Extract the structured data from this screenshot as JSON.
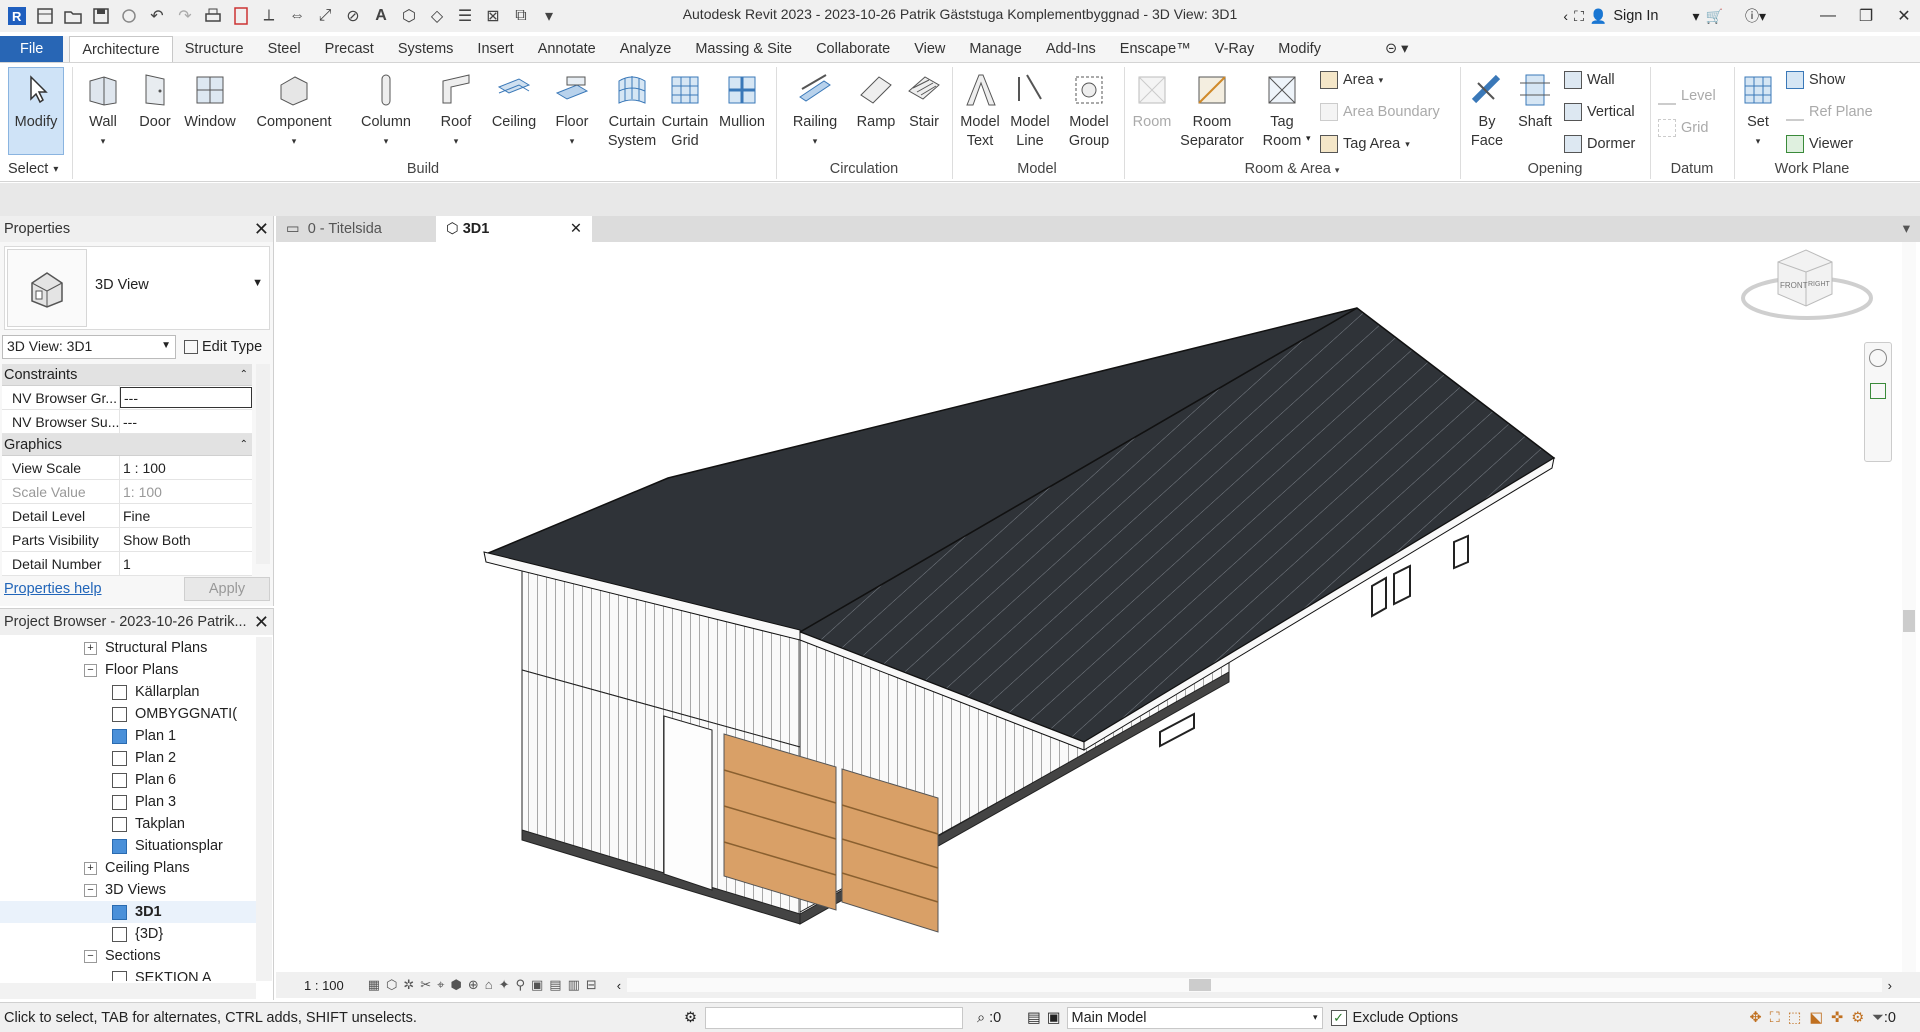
{
  "window": {
    "title": "Autodesk Revit 2023 - 2023-10-26 Patrik Gäststuga Komplementbyggnad - 3D View: 3D1",
    "sign_in": "Sign In"
  },
  "ribbon_tabs": [
    "File",
    "Architecture",
    "Structure",
    "Steel",
    "Precast",
    "Systems",
    "Insert",
    "Annotate",
    "Analyze",
    "Massing & Site",
    "Collaborate",
    "View",
    "Manage",
    "Add-Ins",
    "Enscape™",
    "V-Ray",
    "Modify"
  ],
  "ribbon": {
    "select": {
      "modify": "Modify",
      "select_label": "Select"
    },
    "build": {
      "label": "Build",
      "wall": "Wall",
      "door": "Door",
      "window": "Window",
      "component": "Component",
      "column": "Column",
      "roof": "Roof",
      "ceiling": "Ceiling",
      "floor": "Floor",
      "curtain_system_1": "Curtain",
      "curtain_system_2": "System",
      "curtain_grid_1": "Curtain",
      "curtain_grid_2": "Grid",
      "mullion": "Mullion"
    },
    "circulation": {
      "label": "Circulation",
      "railing": "Railing",
      "ramp": "Ramp",
      "stair": "Stair"
    },
    "model": {
      "label": "Model",
      "model_text_1": "Model",
      "model_text_2": "Text",
      "model_line_1": "Model",
      "model_line_2": "Line",
      "model_group_1": "Model",
      "model_group_2": "Group"
    },
    "room_area": {
      "label": "Room & Area",
      "room": "Room",
      "room_sep_1": "Room",
      "room_sep_2": "Separator",
      "tag_room_1": "Tag",
      "tag_room_2": "Room",
      "area": "Area",
      "area_boundary": "Area  Boundary",
      "tag_area": "Tag  Area"
    },
    "opening": {
      "label": "Opening",
      "by_face_1": "By",
      "by_face_2": "Face",
      "shaft": "Shaft",
      "wall": "Wall",
      "vertical": "Vertical",
      "dormer": "Dormer"
    },
    "datum": {
      "label": "Datum",
      "level": "Level",
      "grid": "Grid"
    },
    "work_plane": {
      "label": "Work Plane",
      "set": "Set",
      "show": "Show",
      "ref_plane": "Ref  Plane",
      "viewer": "Viewer"
    }
  },
  "properties": {
    "title": "Properties",
    "type_name": "3D View",
    "instance": "3D View: 3D1",
    "edit_type": "Edit Type",
    "groups": [
      {
        "name": "Constraints",
        "rows": [
          {
            "key": "NV Browser Gr...",
            "value": "---"
          },
          {
            "key": "NV Browser Su...",
            "value": "---"
          }
        ]
      },
      {
        "name": "Graphics",
        "rows": [
          {
            "key": "View Scale",
            "value": "1 : 100"
          },
          {
            "key": "Scale Value",
            "value": "1: 100"
          },
          {
            "key": "Detail Level",
            "value": "Fine"
          },
          {
            "key": "Parts Visibility",
            "value": "Show Both"
          },
          {
            "key": "Detail Number",
            "value": "1"
          }
        ]
      }
    ],
    "help": "Properties help",
    "apply": "Apply"
  },
  "browser": {
    "title": "Project Browser - 2023-10-26 Patrik...",
    "nodes": [
      {
        "label": "Structural Plans",
        "level": 1,
        "kind": "plus"
      },
      {
        "label": "Floor Plans",
        "level": 1,
        "kind": "minus"
      },
      {
        "label": "Källarplan",
        "level": 2,
        "kind": "leaf"
      },
      {
        "label": "OMBYGGNATI(",
        "level": 2,
        "kind": "leaf"
      },
      {
        "label": "Plan 1",
        "level": 2,
        "kind": "leaf-blue"
      },
      {
        "label": "Plan 2",
        "level": 2,
        "kind": "leaf"
      },
      {
        "label": "Plan 6",
        "level": 2,
        "kind": "leaf"
      },
      {
        "label": "Plan 3",
        "level": 2,
        "kind": "leaf"
      },
      {
        "label": "Takplan",
        "level": 2,
        "kind": "leaf"
      },
      {
        "label": "Situationsplar",
        "level": 2,
        "kind": "leaf-blue"
      },
      {
        "label": "Ceiling Plans",
        "level": 1,
        "kind": "plus"
      },
      {
        "label": "3D Views",
        "level": 1,
        "kind": "minus"
      },
      {
        "label": "3D1",
        "level": 2,
        "kind": "leaf-blue",
        "selected": true
      },
      {
        "label": "{3D}",
        "level": 2,
        "kind": "leaf"
      },
      {
        "label": "Sections",
        "level": 1,
        "kind": "minus"
      },
      {
        "label": "SEKTION A",
        "level": 2,
        "kind": "leaf"
      }
    ]
  },
  "view_tabs": [
    {
      "label": "0 - Titelsida"
    },
    {
      "label": "3D1",
      "active": true
    }
  ],
  "view_bar": {
    "scale": "1 : 100"
  },
  "viewcube": {
    "front": "FRONT",
    "right": "RIGHT"
  },
  "status": {
    "message": "Click to select, TAB for alternates, CTRL adds, SHIFT unselects.",
    "count": ":0",
    "model": "Main Model",
    "exclude": "Exclude Options",
    "filter_count": ":0"
  },
  "colors": {
    "file_tab": "#2866b5",
    "accent_blue": "#4a90d9",
    "roof": "#2f3338",
    "door_wood": "#d9a067"
  }
}
